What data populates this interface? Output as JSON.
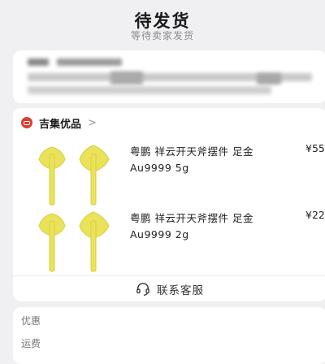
{
  "header": {
    "title": "待发货",
    "subtitle": "等待卖家发货"
  },
  "shop": {
    "name": "吉集优品",
    "chevron": ">",
    "logo_color": "#e23b2e"
  },
  "products": [
    {
      "name": "粤鹏 祥云开天斧摆件 足金 Au9999 5g",
      "price": "¥55",
      "thumb_color": "#e9e25a"
    },
    {
      "name": "粤鹏 祥云开天斧摆件 足金 Au9999 2g",
      "price": "¥22",
      "thumb_color": "#e9e25a"
    }
  ],
  "actions": {
    "customer_service": "联系客服",
    "customer_service_icon": "headset-icon"
  },
  "summary": {
    "discount_label": "优惠",
    "shipping_label": "运费"
  }
}
